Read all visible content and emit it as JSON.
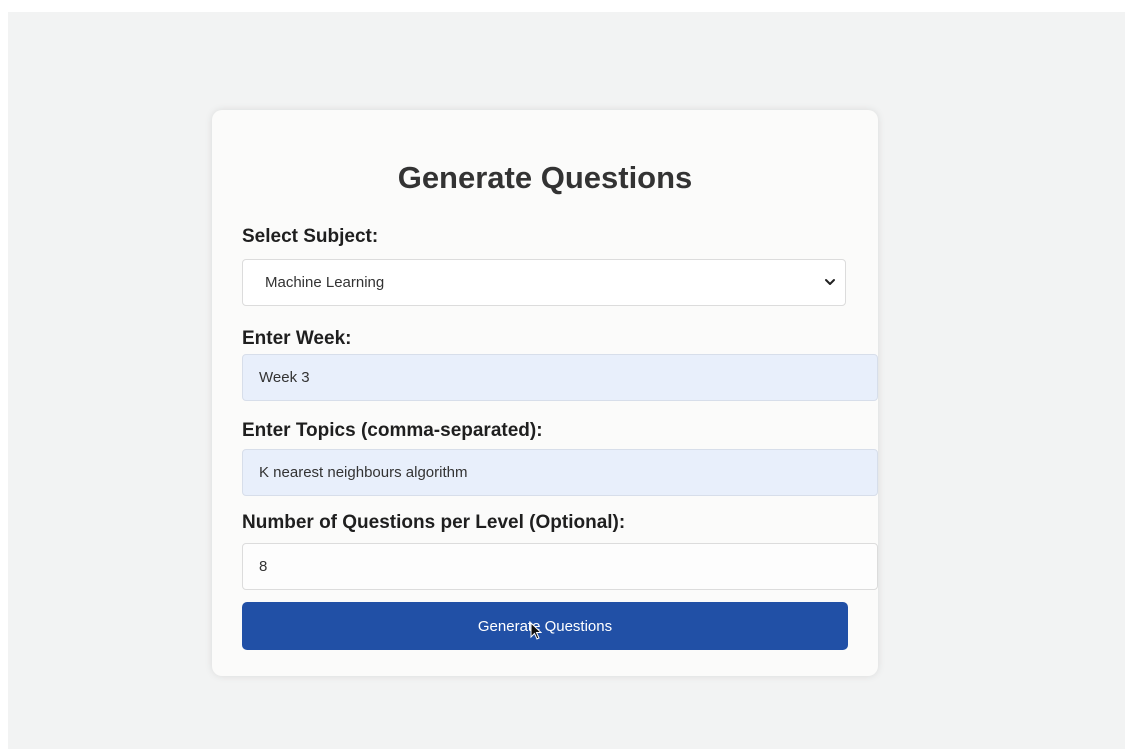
{
  "form": {
    "title": "Generate Questions",
    "subject_label": "Select Subject:",
    "subject_value": "Machine Learning",
    "week_label": "Enter Week:",
    "week_value": "Week 3",
    "topics_label": "Enter Topics (comma-separated):",
    "topics_value": "K nearest neighbours algorithm",
    "count_label": "Number of Questions per Level (Optional):",
    "count_value": "8",
    "submit_label": "Generate Questions"
  },
  "icons": {
    "select_arrow": "chevron-down-icon",
    "mouse_cursor": "cursor-pointer-icon"
  },
  "colors": {
    "page_background": "#f2f3f3",
    "card_background": "#fbfbfa",
    "button_background": "#2150a6",
    "filled_input_background": "#e8effb"
  }
}
